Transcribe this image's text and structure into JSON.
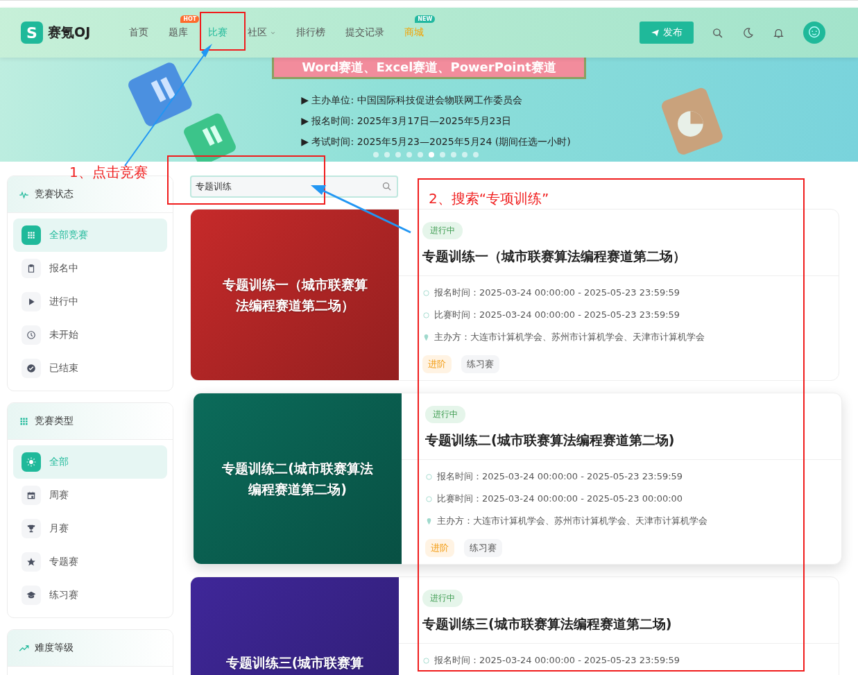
{
  "header": {
    "logo_mark": "S",
    "logo_text": "赛氪OJ",
    "nav": [
      {
        "label": "首页",
        "selected": false,
        "highlighted": false,
        "dropdown": false
      },
      {
        "label": "题库",
        "selected": false,
        "highlighted": false,
        "dropdown": false,
        "badge": {
          "text": "HOT",
          "color": "#ff6a2b"
        }
      },
      {
        "label": "比赛",
        "selected": true,
        "highlighted": false,
        "dropdown": false
      },
      {
        "label": "社区",
        "selected": false,
        "highlighted": false,
        "dropdown": true
      },
      {
        "label": "排行榜",
        "selected": false,
        "highlighted": false,
        "dropdown": false
      },
      {
        "label": "提交记录",
        "selected": false,
        "highlighted": false,
        "dropdown": false
      },
      {
        "label": "商城",
        "selected": false,
        "highlighted": true,
        "dropdown": false,
        "badge": {
          "text": "NEW",
          "color": "#22b8a0"
        }
      }
    ],
    "publish_button": "发布"
  },
  "banner": {
    "ribbon": "Word赛道、Excel赛道、PowerPoint赛道",
    "lines": [
      "▶ 主办单位: 中国国际科技促进会物联网工作委员会",
      "▶ 报名时间: 2025年3月17日—2025年5月23日",
      "▶ 考试时间: 2025年5月23—2025年5月24 (期间任选一小时)"
    ],
    "dots": [
      {
        "selected": false
      },
      {
        "selected": false
      },
      {
        "selected": false
      },
      {
        "selected": false
      },
      {
        "selected": false
      },
      {
        "selected": true
      },
      {
        "selected": false
      },
      {
        "selected": false
      },
      {
        "selected": false
      },
      {
        "selected": false
      }
    ]
  },
  "sidebar": [
    {
      "title": "竞赛状态",
      "items": [
        {
          "label": "全部竞赛",
          "selected": true
        },
        {
          "label": "报名中",
          "selected": false
        },
        {
          "label": "进行中",
          "selected": false
        },
        {
          "label": "未开始",
          "selected": false
        },
        {
          "label": "已结束",
          "selected": false
        }
      ]
    },
    {
      "title": "竞赛类型",
      "items": [
        {
          "label": "全部",
          "selected": true
        },
        {
          "label": "周赛",
          "selected": false
        },
        {
          "label": "月赛",
          "selected": false
        },
        {
          "label": "专题赛",
          "selected": false
        },
        {
          "label": "练习赛",
          "selected": false
        }
      ]
    },
    {
      "title": "难度等级"
    }
  ],
  "search": {
    "value": "专题训练"
  },
  "contests": [
    {
      "cover_title": "专题训练一（城市联赛算法编程赛道第二场）",
      "color": "#c62a2a",
      "hovered": false,
      "status": "进行中",
      "title": "专题训练一（城市联赛算法编程赛道第二场）",
      "info": [
        "报名时间：2025-03-24 00:00:00 - 2025-05-23 23:59:59",
        "比赛时间：2025-03-24 00:00:00 - 2025-05-23 23:59:59",
        "主办方：大连市计算机学会、苏州市计算机学会、天津市计算机学会"
      ],
      "tags": [
        {
          "label": "进阶",
          "kind": "level"
        },
        {
          "label": "练习赛",
          "kind": "type"
        }
      ]
    },
    {
      "cover_title": "专题训练二(城市联赛算法编程赛道第二场)",
      "color": "#0b6b5a",
      "hovered": true,
      "status": "进行中",
      "title": "专题训练二(城市联赛算法编程赛道第二场)",
      "info": [
        "报名时间：2025-03-24 00:00:00 - 2025-05-23 23:59:59",
        "比赛时间：2025-03-24 00:00:00 - 2025-05-23 00:00:00",
        "主办方：大连市计算机学会、苏州市计算机学会、天津市计算机学会"
      ],
      "tags": [
        {
          "label": "进阶",
          "kind": "level"
        },
        {
          "label": "练习赛",
          "kind": "type"
        }
      ]
    },
    {
      "cover_title": "专题训练三(城市联赛算",
      "color": "#3f2799",
      "hovered": false,
      "status": "进行中",
      "title": "专题训练三(城市联赛算法编程赛道第二场)",
      "info": [
        "报名时间：2025-03-24 00:00:00 - 2025-05-23 23:59:59"
      ]
    }
  ],
  "annotations": [
    "1、点击竞赛",
    "2、搜索“专项训练”"
  ]
}
